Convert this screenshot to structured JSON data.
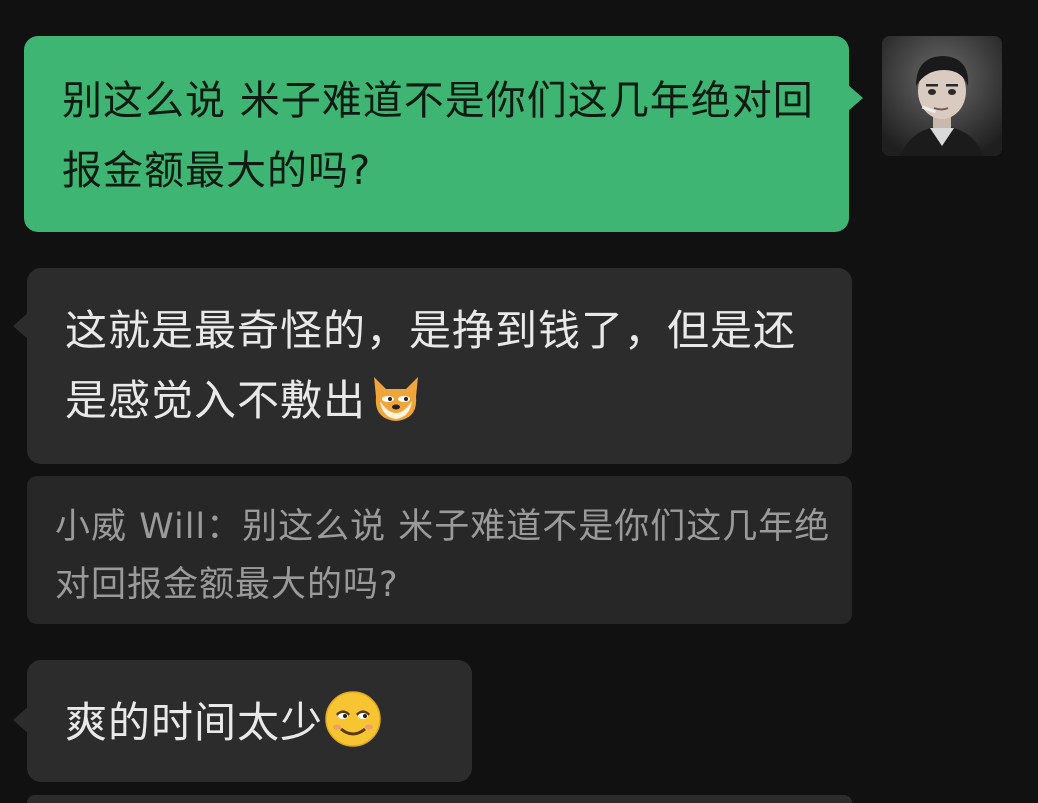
{
  "messages": {
    "outgoing_1": "别这么说 米子难道不是你们这几年绝对回报金额最大的吗?",
    "incoming_1": "这就是最奇怪的，是挣到钱了，但是还是感觉入不敷出",
    "quote": "小威 Will：别这么说 米子难道不是你们这几年绝对回报金额最大的吗?",
    "incoming_2": "爽的时间太少"
  },
  "icons": {
    "emoji_1": "doge-emoji-icon",
    "emoji_2": "smirk-emoji-icon",
    "avatar": "user-avatar-icon"
  },
  "colors": {
    "background": "#111111",
    "outgoing_bubble": "#3fb573",
    "incoming_bubble": "#2c2c2c",
    "quote_block": "#272727",
    "quote_text": "#9a9a9a"
  }
}
